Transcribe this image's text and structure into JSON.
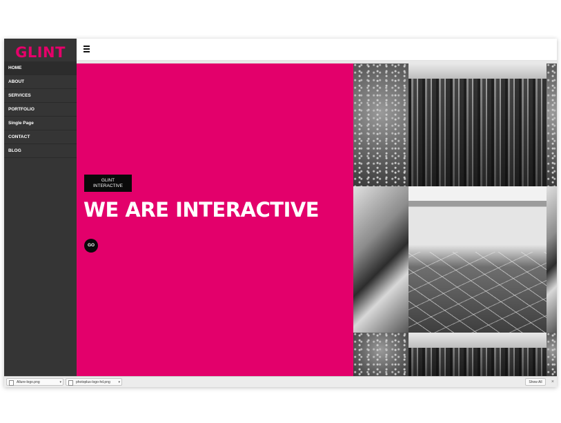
{
  "sidebar": {
    "logo": "GLINT",
    "items": [
      {
        "label": "HOME"
      },
      {
        "label": "ABOUT"
      },
      {
        "label": "SERVICES"
      },
      {
        "label": "PORTFOLIO"
      },
      {
        "label": "Single Page"
      },
      {
        "label": "CONTACT"
      },
      {
        "label": "BLOG"
      }
    ]
  },
  "topbar": {
    "menu_icon": "hamburger-menu-icon"
  },
  "hero": {
    "tag_line1": "GLINT",
    "tag_line2": "INTERACTIVE",
    "title": "WE ARE INTERACTIVE",
    "go_label": "GO"
  },
  "downloads": {
    "items": [
      {
        "name": "Allure-logo.png"
      },
      {
        "name": "photoplus-logo-hd.png"
      }
    ],
    "show_all": "Show All",
    "close_label": "×"
  },
  "colors": {
    "accent": "#e3006b",
    "sidebar": "#353535"
  }
}
